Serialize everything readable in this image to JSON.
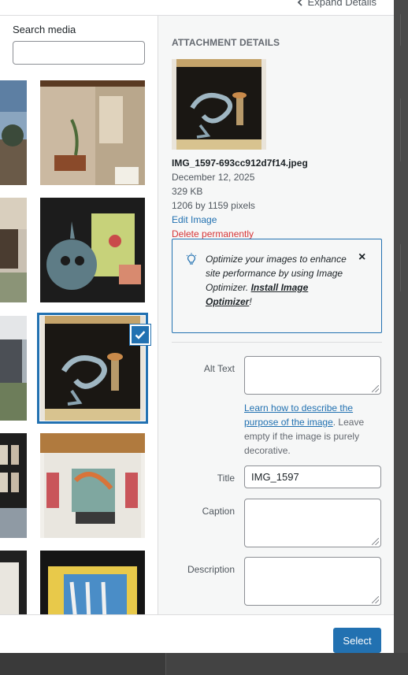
{
  "header": {
    "expand_label": "Expand Details"
  },
  "search": {
    "label": "Search media",
    "value": "",
    "placeholder": ""
  },
  "grid": {
    "selected_index": 5
  },
  "details": {
    "heading": "ATTACHMENT DETAILS",
    "filename": "IMG_1597-693cc912d7f14.jpeg",
    "date": "December 12, 2025",
    "size": "329 KB",
    "dimensions": "1206 by 1159 pixels",
    "edit_link": "Edit Image",
    "delete_link": "Delete permanently"
  },
  "notice": {
    "text": "Optimize your images to enhance site performance by using Image Optimizer. ",
    "link": "Install Image Optimizer",
    "suffix": "!",
    "close": "×"
  },
  "fields": {
    "alt_label": "Alt Text",
    "alt_value": "",
    "help_link": "Learn how to describe the purpose of the image",
    "help_text": ". Leave empty if the image is purely decorative.",
    "title_label": "Title",
    "title_value": "IMG_1597",
    "caption_label": "Caption",
    "caption_value": "",
    "description_label": "Description",
    "description_value": ""
  },
  "footer": {
    "select_label": "Select"
  },
  "colors": {
    "primary": "#2271b1",
    "danger": "#d63638",
    "sidebar_bg": "#f6f7f7"
  }
}
